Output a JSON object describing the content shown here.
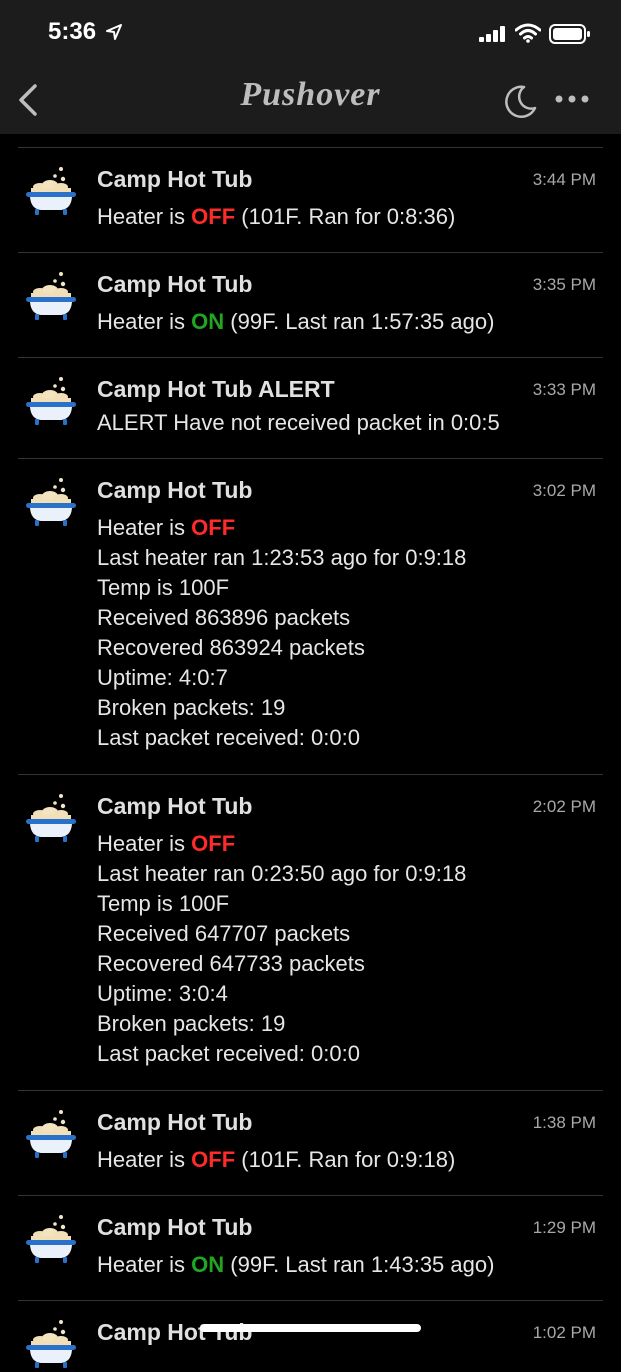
{
  "status": {
    "time": "5:36"
  },
  "nav": {
    "title": "Pushover"
  },
  "messages": [
    {
      "app": "Camp Hot Tub",
      "time": "3:44 PM",
      "lines": [
        {
          "pre": "Heater is ",
          "status": "OFF",
          "post": " (101F. Ran for 0:8:36)"
        }
      ]
    },
    {
      "app": "Camp Hot Tub",
      "time": "3:35 PM",
      "lines": [
        {
          "pre": "Heater is ",
          "status": "ON",
          "post": " (99F. Last ran 1:57:35 ago)"
        }
      ]
    },
    {
      "app": "Camp Hot Tub ALERT",
      "time": "3:33 PM",
      "lines": [
        {
          "pre": "ALERT Have not received packet in 0:0:5"
        }
      ]
    },
    {
      "app": "Camp Hot Tub",
      "time": "3:02 PM",
      "lines": [
        {
          "pre": "Heater is ",
          "status": "OFF",
          "post": ""
        },
        {
          "pre": "Last heater ran 1:23:53 ago for 0:9:18"
        },
        {
          "pre": "Temp is 100F"
        },
        {
          "pre": "Received 863896 packets"
        },
        {
          "pre": "Recovered 863924 packets"
        },
        {
          "pre": "Uptime: 4:0:7"
        },
        {
          "pre": "Broken packets: 19"
        },
        {
          "pre": "Last packet received: 0:0:0"
        }
      ]
    },
    {
      "app": "Camp Hot Tub",
      "time": "2:02 PM",
      "lines": [
        {
          "pre": "Heater is ",
          "status": "OFF",
          "post": ""
        },
        {
          "pre": "Last heater ran 0:23:50 ago for 0:9:18"
        },
        {
          "pre": "Temp is 100F"
        },
        {
          "pre": "Received 647707 packets"
        },
        {
          "pre": "Recovered 647733 packets"
        },
        {
          "pre": "Uptime: 3:0:4"
        },
        {
          "pre": "Broken packets: 19"
        },
        {
          "pre": "Last packet received: 0:0:0"
        }
      ]
    },
    {
      "app": "Camp Hot Tub",
      "time": "1:38 PM",
      "lines": [
        {
          "pre": "Heater is ",
          "status": "OFF",
          "post": " (101F. Ran for 0:9:18)"
        }
      ]
    },
    {
      "app": "Camp Hot Tub",
      "time": "1:29 PM",
      "lines": [
        {
          "pre": "Heater is ",
          "status": "ON",
          "post": " (99F. Last ran 1:43:35 ago)"
        }
      ]
    },
    {
      "app": "Camp Hot Tub",
      "time": "1:02 PM",
      "lines": []
    }
  ],
  "colors": {
    "off": "#ff2a2a",
    "on": "#21a621",
    "background": "#000000",
    "bar": "#1c1c1c"
  },
  "icons": {
    "status": [
      "location-arrow-icon",
      "signal-icon",
      "wifi-icon",
      "battery-icon"
    ],
    "nav": [
      "back-chevron-icon",
      "moon-icon",
      "more-icon"
    ],
    "message": "bathtub-icon"
  }
}
